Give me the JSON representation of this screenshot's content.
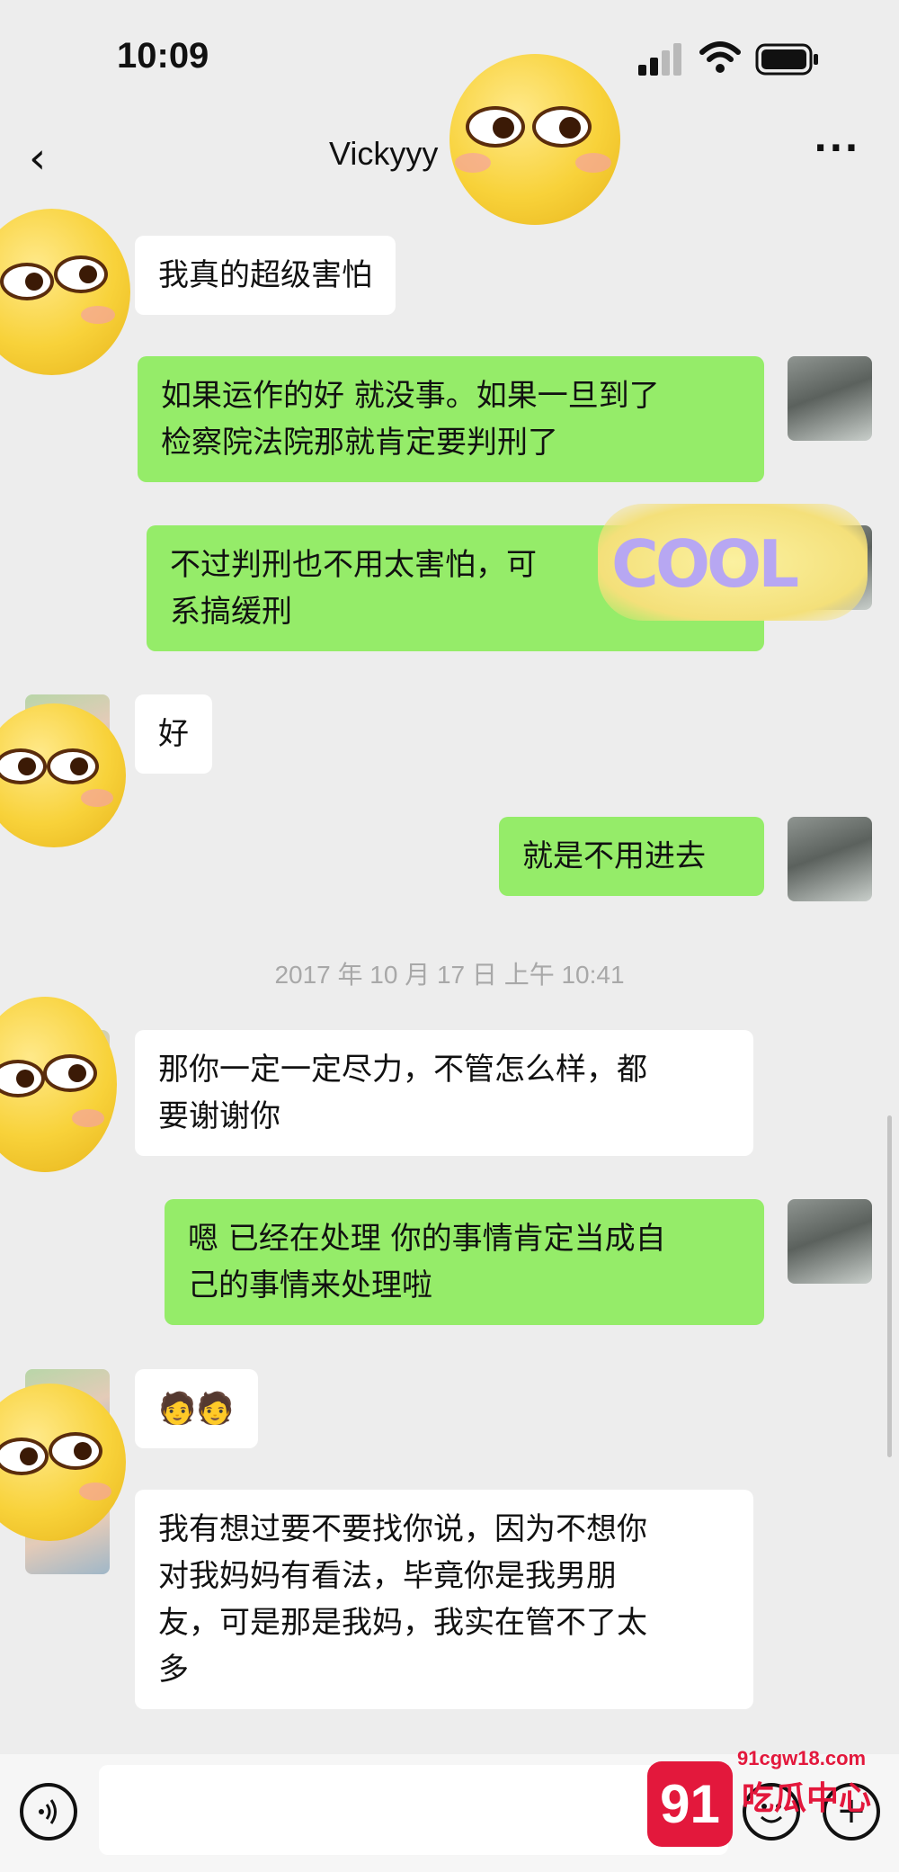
{
  "status": {
    "time": "10:09"
  },
  "nav": {
    "back_label": "‹",
    "title": "Vickyyy",
    "more_label": "···"
  },
  "messages": [
    {
      "side": "left",
      "text": "我真的超级害怕"
    },
    {
      "side": "right",
      "text": "如果运作的好 就没事。如果一旦到了\n检察院法院那就肯定要判刑了"
    },
    {
      "side": "right",
      "text": "不过判刑也不用太害怕，可\n系搞缓刑"
    },
    {
      "side": "left",
      "text": "好"
    },
    {
      "side": "right",
      "text": "就是不用进去"
    },
    {
      "side": "left",
      "text": "那你一定一定尽力，不管怎么样，都\n要谢谢你"
    },
    {
      "side": "right",
      "text": "嗯 已经在处理 你的事情肯定当成自\n己的事情来处理啦"
    },
    {
      "side": "left",
      "text": "🧑🧑"
    },
    {
      "side": "left",
      "text": "我有想过要不要找你说，因为不想你\n对我妈妈有看法，毕竟你是我男朋\n友，可是那是我妈，我实在管不了太\n多"
    }
  ],
  "timestamp": "2017 年 10 月 17 日  上午 10:41",
  "sticker": {
    "text": "COOL"
  },
  "watermark": {
    "badge": "91",
    "url": "91cgw18.com",
    "name": "吃瓜中心"
  },
  "bottom": {
    "voice_icon": "voice-icon",
    "emoji_icon": "emoji-icon",
    "plus_label": "+"
  },
  "colors": {
    "green_bubble": "#95ec69",
    "white_bubble": "#ffffff",
    "background": "#ededed",
    "watermark": "#e3183c"
  }
}
